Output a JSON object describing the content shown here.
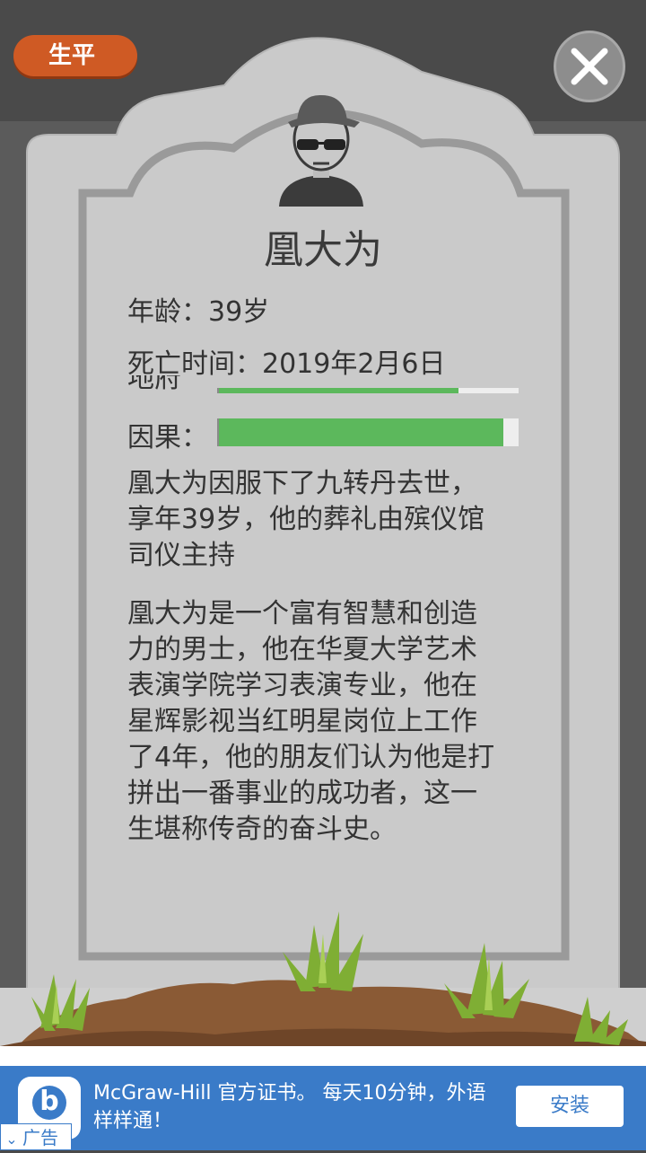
{
  "header": {
    "life_button_label": "生平"
  },
  "profile": {
    "name": "凰大为",
    "age_label": "年龄：39岁",
    "death_label": "死亡时间：2019年2月6日",
    "cut_off_label": "地府",
    "karma_label": "因果：",
    "upper_bar_fill": 0.8,
    "karma_bar_fill": 0.95
  },
  "story": {
    "paragraph_1": "凰大为因服下了九转丹去世，享年39岁，他的葬礼由殡仪馆司仪主持",
    "paragraph_2": "凰大为是一个富有智慧和创造力的男士，他在华夏大学艺术表演学院学习表演专业，他在星辉影视当红明星岗位上工作了4年，他的朋友们认为他是打拼出一番事业的成功者，这一生堪称传奇的奋斗史。"
  },
  "ad": {
    "text": "McGraw-Hill 官方证书。 每天10分钟，外语样样通！",
    "install_label": "安装",
    "badge_label": "广告",
    "logo_letter": "b"
  },
  "colors": {
    "stone": "#cacaca",
    "stone_border": "#9a9a9a",
    "accent": "#cf5a24",
    "bar_green": "#5cb85c",
    "ad_blue": "#3a7bc8"
  },
  "icons": [
    "close-icon",
    "avatar-icon",
    "grass-icon",
    "ad-logo-icon",
    "chevron-down-icon"
  ]
}
